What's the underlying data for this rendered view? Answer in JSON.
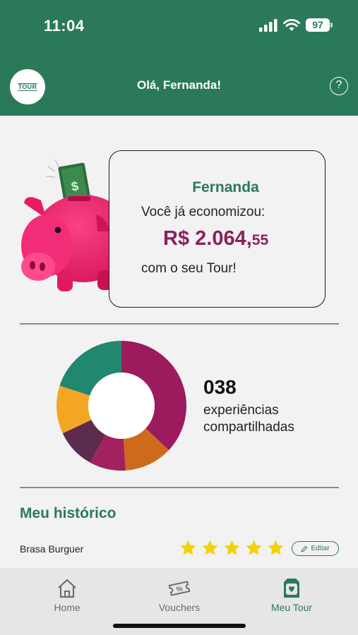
{
  "status_bar": {
    "time": "11:04",
    "battery": "97"
  },
  "header": {
    "logo_text": "TOUR",
    "greeting": "Olá, Fernanda!",
    "help_symbol": "?"
  },
  "savings": {
    "name": "Fernanda",
    "line1": "Você já economizou:",
    "amount_main": "R$ 2.064,",
    "amount_cents": "55",
    "line2": "com o seu Tour!"
  },
  "experiences": {
    "count": "038",
    "label": "experiências compartilhadas",
    "segment_colors": [
      "#9b1b5e",
      "#cf6a1d",
      "#a3215f",
      "#5b2c4d",
      "#f3a623",
      "#21876f"
    ]
  },
  "history": {
    "title": "Meu histórico",
    "items": [
      {
        "name": "Brasa Burguer",
        "rating": 5,
        "edit_label": "Editar"
      }
    ]
  },
  "nav": {
    "items": [
      {
        "label": "Home",
        "icon": "home-icon"
      },
      {
        "label": "Vouchers",
        "icon": "voucher-icon"
      },
      {
        "label": "Meu Tour",
        "icon": "meu-tour-icon",
        "active": true
      }
    ]
  },
  "colors": {
    "brand_green": "#2a7a5a",
    "amount_purple": "#8c1f5e",
    "star_yellow": "#f5d10a",
    "piggy_pink": "#f0216e"
  }
}
